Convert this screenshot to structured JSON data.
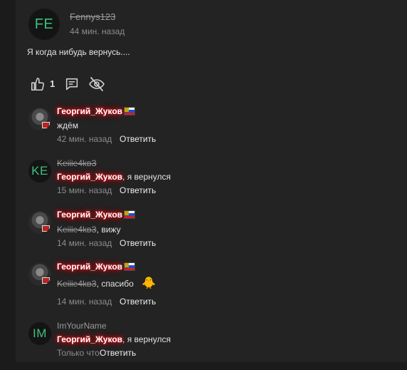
{
  "post": {
    "avatar_initials": "FE",
    "author": "Fennys123",
    "time": "44 мин. назад",
    "text": "Я когда нибудь вернусь....",
    "likes": "1"
  },
  "comments": [
    {
      "author": "Георгий_Жуков",
      "text": "ждём",
      "time": "42 мин. назад",
      "reply": "Ответить"
    },
    {
      "avatar_initials": "KE",
      "author": "Keiiie4kвЗ",
      "mention": "Георгий_Жуков",
      "text": ", я вернулся",
      "time": "15 мин. назад",
      "reply": "Ответить"
    },
    {
      "author": "Георгий_Жуков",
      "mention": "Keiiie4kвЗ",
      "text": ", вижу",
      "time": "14 мин. назад",
      "reply": "Ответить"
    },
    {
      "author": "Георгий_Жуков",
      "mention": "Keiiie4kвЗ",
      "text": ", спасибо",
      "emoji": "🐥",
      "time": "14 мин. назад",
      "reply": "Ответить"
    },
    {
      "avatar_initials": "IM",
      "author": "ImYourName",
      "mention": "Георгий_Жуков",
      "text": ", я вернулся",
      "time": "Только что",
      "reply": "Ответить"
    }
  ],
  "colors": {
    "background": "#1b1b1b",
    "panel": "#232323",
    "initials": "#3fbf7f",
    "name_glow": "#e0101a"
  },
  "icons": [
    "thumbs-up-icon",
    "comment-icon",
    "eye-off-icon",
    "flag-icon",
    "duck-emoji-icon"
  ]
}
